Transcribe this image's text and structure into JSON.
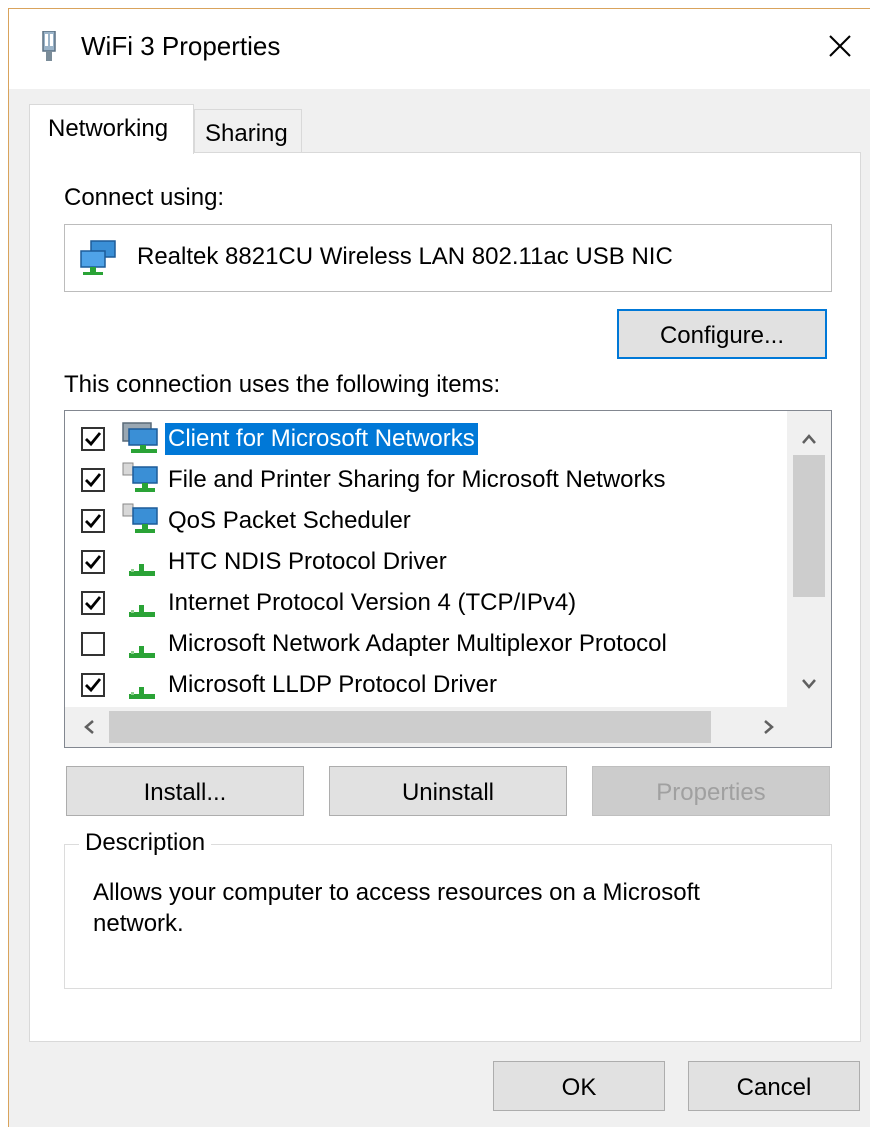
{
  "window": {
    "title": "WiFi 3 Properties",
    "close_glyph": "✕"
  },
  "tabs": [
    {
      "label": "Networking",
      "active": true
    },
    {
      "label": "Sharing",
      "active": false
    }
  ],
  "connect_using": {
    "label": "Connect using:",
    "adapter_name": "Realtek 8821CU Wireless LAN 802.11ac USB NIC",
    "configure_label": "Configure..."
  },
  "items_section": {
    "label": "This connection uses the following items:",
    "items": [
      {
        "label": "Client for Microsoft Networks",
        "checked": true,
        "selected": true,
        "icon": "network-client-icon"
      },
      {
        "label": "File and Printer Sharing for Microsoft Networks",
        "checked": true,
        "selected": false,
        "icon": "network-service-icon"
      },
      {
        "label": "QoS Packet Scheduler",
        "checked": true,
        "selected": false,
        "icon": "network-service-icon"
      },
      {
        "label": "HTC NDIS Protocol Driver",
        "checked": true,
        "selected": false,
        "icon": "protocol-icon"
      },
      {
        "label": "Internet Protocol Version 4 (TCP/IPv4)",
        "checked": true,
        "selected": false,
        "icon": "protocol-icon"
      },
      {
        "label": "Microsoft Network Adapter Multiplexor Protocol",
        "checked": false,
        "selected": false,
        "icon": "protocol-icon"
      },
      {
        "label": "Microsoft LLDP Protocol Driver",
        "checked": true,
        "selected": false,
        "icon": "protocol-icon"
      }
    ]
  },
  "buttons": {
    "install": "Install...",
    "uninstall": "Uninstall",
    "properties": "Properties",
    "ok": "OK",
    "cancel": "Cancel"
  },
  "description": {
    "legend": "Description",
    "text": "Allows your computer to access resources on a Microsoft network."
  },
  "colors": {
    "accent": "#0078d7",
    "protocol_green": "#2aa336",
    "monitor_blue": "#3a8fd6"
  }
}
